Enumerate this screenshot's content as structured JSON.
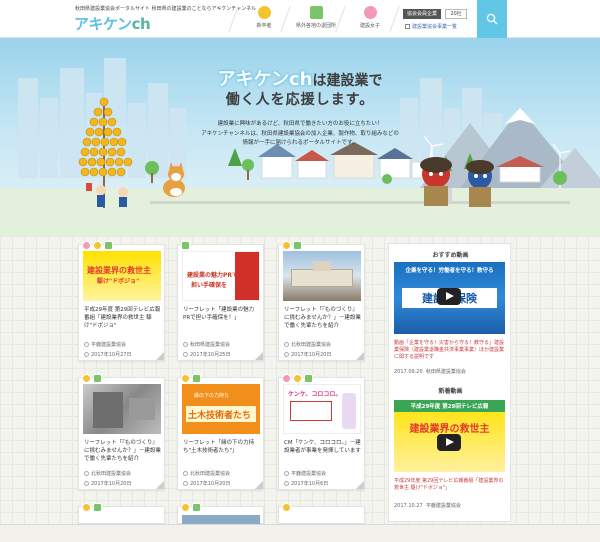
{
  "header": {
    "tagline": "秋田県建設業協会ポータルサイト 秋田県の建設業のことならアキケンチャンネル",
    "logo_main": "アキケン",
    "logo_ch": "ch",
    "nav": [
      {
        "label": "新卒者",
        "icon": "student-icon",
        "color": "#f4c430"
      },
      {
        "label": "県外各地の退団所",
        "icon": "building-icon",
        "color": "#7cc46a"
      },
      {
        "label": "建設女子",
        "icon": "woman-icon",
        "color": "#f39ab8"
      }
    ],
    "member_button": "協会会員企業",
    "count": "20社",
    "sub_link": "建設業協会事業一覧"
  },
  "hero": {
    "brand": "アキケンch",
    "line1_suffix": "は建設業で",
    "line2": "働く人を応援します。",
    "desc": [
      "建設業に興味があるけど、秋田県で働きたい方のお役に立ちたい！",
      "アキケンチャンネルは、秋田県建設業協会の加入企業、製作物、取り組みなどの",
      "情報が一手に届けられるポータルサイトです。"
    ]
  },
  "cards": [
    {
      "title": "平成29年度 第29回テレビ広報番組「建設業界の救世主 駆け\"ドボジョ\"",
      "org": "平鹿建設業協会",
      "date": "2017年10月27日",
      "thumb_text": "建設業界の救世主",
      "thumb_sub": "駆け\"ドボジョ\""
    },
    {
      "title": "リーフレット「建設業の魅力PRで担い手確保を！」",
      "org": "秋田県建設業協会",
      "date": "2017年10月25日",
      "thumb_text": "建設業の魅力PRで",
      "thumb_sub": "担い手確保を"
    },
    {
      "title": "リーフレット「『ものづくり』に挑むみませんか？」－建設業で働く先輩たちを紹介",
      "org": "北秋田建設業協会",
      "date": "2017年10月20日",
      "thumb_text": "",
      "thumb_sub": ""
    },
    {
      "title": "リーフレット「『ものづくり』に挑むみませんか？」－建設業で働く先輩たちを紹介",
      "org": "北秋田建設業協会",
      "date": "2017年10月20日",
      "thumb_text": "",
      "thumb_sub": ""
    },
    {
      "title": "リーフレット「縁の下の力持ち\"土木技術者たち\"」",
      "org": "北秋田建設業協会",
      "date": "2017年10月20日",
      "thumb_text": "土木技術者たち",
      "thumb_sub": "縁の下の力持ち"
    },
    {
      "title": "CM「ケンケ、コロコロ。」－建設業者が事業を発揮しています",
      "org": "平鹿建設業協会",
      "date": "2017年10月6日",
      "thumb_text": "ケンケ、コロコロ。",
      "thumb_sub": ""
    }
  ],
  "sidebar": {
    "heading_recommended": "おすすめ動画",
    "heading_new": "新着動画",
    "video1": {
      "title": "動画「企業を守る！災害から守る！教守る」建設業保険（建設業退職金共済事業事業）ほか建設業に関する説明です",
      "date": "2017.09.20",
      "org": "秋田県建設業協会",
      "banner": "建設業保険",
      "banner_top": "企業を守る！労働者を守る！教守る"
    },
    "video2": {
      "title": "平成29年度 第29回テレビ広報番組「建設業界の救世主 駆け\"ドボジョ\"」",
      "date": "2017.10.27",
      "org": "平鹿建設業協会",
      "banner": "建設業界の救世主",
      "banner_top": "平成29年度 第29回テレビ広報"
    }
  },
  "colors": {
    "accent": "#62c6e6",
    "logo_blue": "#5cc0e4",
    "logo_green": "#55b6a0",
    "link_red": "#c93b3b"
  }
}
